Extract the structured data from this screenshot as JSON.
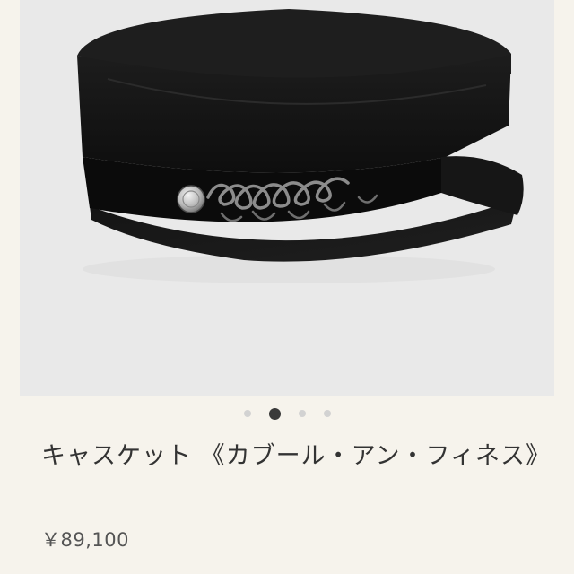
{
  "product": {
    "image_alt": "hat-photo",
    "title": "キャスケット 《カブール・アン・フィネス》",
    "price": "￥89,100"
  },
  "carousel": {
    "total_slides": 4,
    "active_index": 1
  },
  "colors": {
    "background": "#f6f3ec",
    "image_background": "#e9e9e9",
    "dot_active": "#3a3a3a",
    "dot_inactive": "#d2d2d2",
    "title_text": "#333333",
    "price_text": "#555555"
  }
}
